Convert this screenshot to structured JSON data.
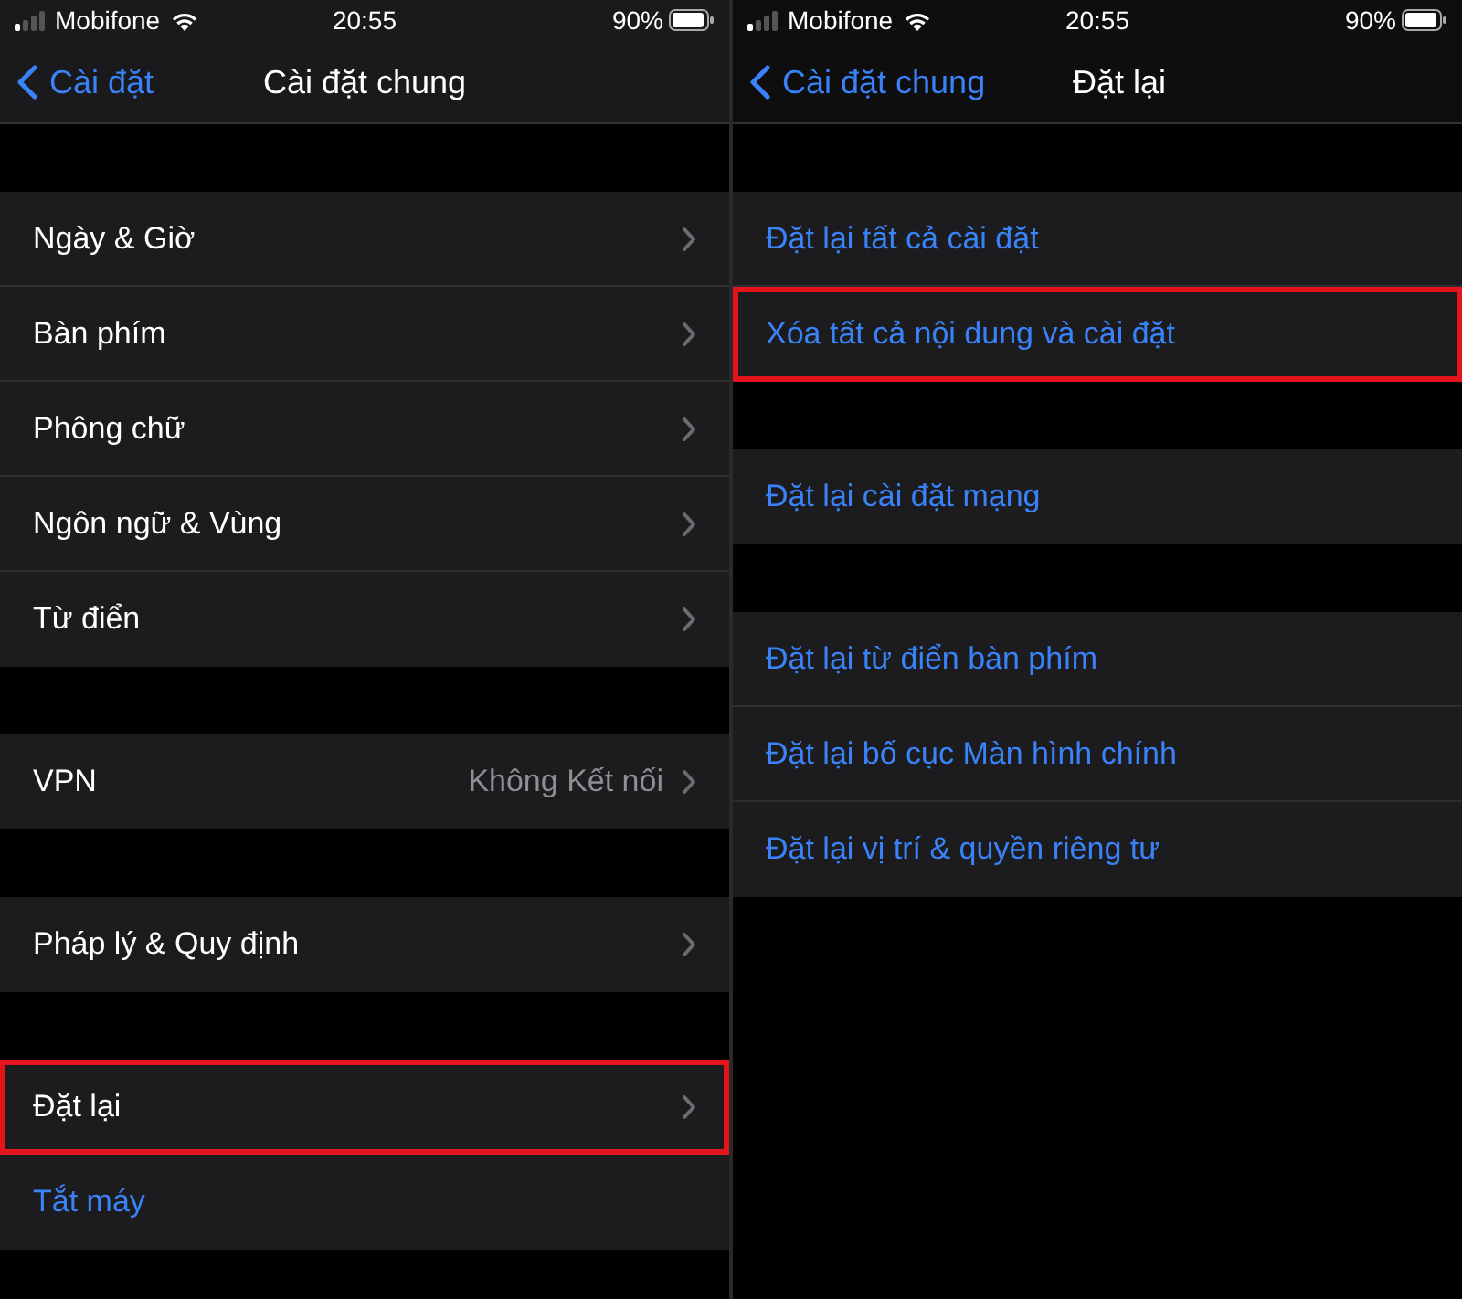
{
  "panels": [
    {
      "status_bar": {
        "carrier": "Mobifone",
        "time": "20:55",
        "battery": "90%"
      },
      "nav": {
        "back": "Cài đặt",
        "title": "Cài đặt chung"
      },
      "groups": [
        {
          "rows": [
            {
              "kind": "link",
              "label": "Ngày & Giờ",
              "highlighted": false
            },
            {
              "kind": "link",
              "label": "Bàn phím",
              "highlighted": false
            },
            {
              "kind": "link",
              "label": "Phông chữ",
              "highlighted": false
            },
            {
              "kind": "link",
              "label": "Ngôn ngữ & Vùng",
              "highlighted": false
            },
            {
              "kind": "link",
              "label": "Từ điển",
              "highlighted": false
            }
          ]
        },
        {
          "rows": [
            {
              "kind": "link",
              "label": "VPN",
              "value": "Không Kết nối",
              "highlighted": false
            }
          ]
        },
        {
          "rows": [
            {
              "kind": "link",
              "label": "Pháp lý & Quy định",
              "highlighted": false
            }
          ]
        },
        {
          "rows": [
            {
              "kind": "link",
              "label": "Đặt lại",
              "highlighted": true
            },
            {
              "kind": "action",
              "label": "Tắt máy",
              "highlighted": false
            }
          ]
        }
      ]
    },
    {
      "status_bar": {
        "carrier": "Mobifone",
        "time": "20:55",
        "battery": "90%"
      },
      "nav": {
        "back": "Cài đặt chung",
        "title": "Đặt lại"
      },
      "groups": [
        {
          "rows": [
            {
              "kind": "action",
              "label": "Đặt lại tất cả cài đặt",
              "highlighted": false
            },
            {
              "kind": "action",
              "label": "Xóa tất cả nội dung và cài đặt",
              "highlighted": true
            }
          ]
        },
        {
          "rows": [
            {
              "kind": "action",
              "label": "Đặt lại cài đặt mạng",
              "highlighted": false
            }
          ]
        },
        {
          "rows": [
            {
              "kind": "action",
              "label": "Đặt lại từ điển bàn phím",
              "highlighted": false
            },
            {
              "kind": "action",
              "label": "Đặt lại bố cục Màn hình chính",
              "highlighted": false
            },
            {
              "kind": "action",
              "label": "Đặt lại vị trí & quyền riêng tư",
              "highlighted": false
            }
          ]
        }
      ]
    }
  ]
}
